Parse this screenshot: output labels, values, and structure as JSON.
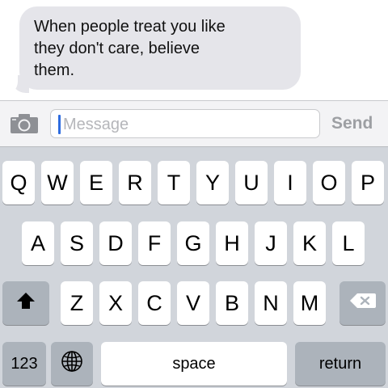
{
  "conversation": {
    "bubble_lines": [
      "When people treat you like",
      "they don't care, believe",
      "them."
    ]
  },
  "input_bar": {
    "camera_icon": "camera-icon",
    "message_placeholder": "Message",
    "send_label": "Send"
  },
  "keyboard": {
    "row1": [
      "Q",
      "W",
      "E",
      "R",
      "T",
      "Y",
      "U",
      "I",
      "O",
      "P"
    ],
    "row2": [
      "A",
      "S",
      "D",
      "F",
      "G",
      "H",
      "J",
      "K",
      "L"
    ],
    "row3": [
      "Z",
      "X",
      "C",
      "V",
      "B",
      "N",
      "M"
    ],
    "shift_icon": "shift-icon",
    "delete_icon": "delete-icon",
    "numbers_label": "123",
    "globe_icon": "globe-icon",
    "space_label": "space",
    "return_label": "return"
  }
}
